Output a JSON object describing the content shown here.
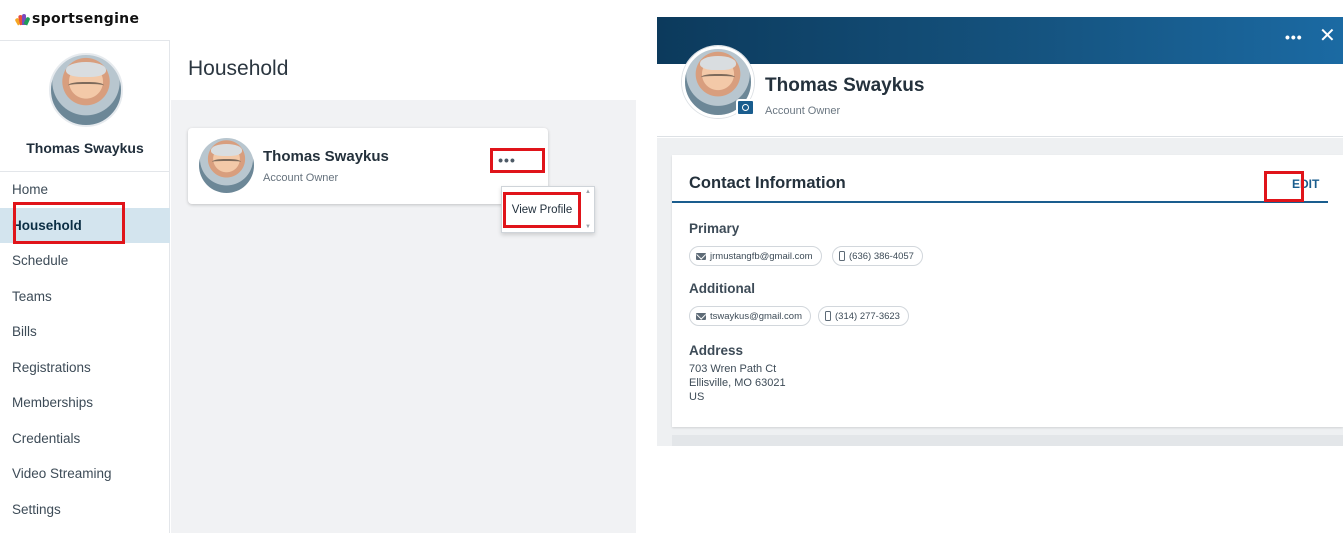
{
  "left": {
    "brand": "sportsengine",
    "sidebar": {
      "user_name": "Thomas Swaykus",
      "items": [
        {
          "label": "Home"
        },
        {
          "label": "Household"
        },
        {
          "label": "Schedule"
        },
        {
          "label": "Teams"
        },
        {
          "label": "Bills"
        },
        {
          "label": "Registrations"
        },
        {
          "label": "Memberships"
        },
        {
          "label": "Credentials"
        },
        {
          "label": "Video Streaming"
        },
        {
          "label": "Settings"
        }
      ],
      "active_item": "Household"
    },
    "main": {
      "title": "Household",
      "member": {
        "name": "Thomas Swaykus",
        "role": "Account Owner",
        "more_label": "•••"
      },
      "dropdown": {
        "items": [
          {
            "label": "View Profile"
          }
        ]
      }
    }
  },
  "right": {
    "banner": {
      "more_label": "•••",
      "close_label": "✕"
    },
    "profile": {
      "name": "Thomas Swaykus",
      "role": "Account Owner"
    },
    "contact": {
      "title": "Contact Information",
      "edit_label": "EDIT",
      "primary": {
        "label": "Primary",
        "email": "jrmustangfb@gmail.com",
        "phone": "(636) 386-4057"
      },
      "additional": {
        "label": "Additional",
        "email": "tswaykus@gmail.com",
        "phone": "(314) 277-3623"
      },
      "address": {
        "label": "Address",
        "line1": "703 Wren Path Ct",
        "line2": "Ellisville, MO 63021",
        "line3": "US"
      }
    }
  },
  "colors": {
    "highlight": "#e0141a",
    "active_nav_bg": "#d3e4ee",
    "accent": "#1a5d8e",
    "banner_start": "#0c3a5c",
    "banner_end": "#1b6aa3"
  }
}
